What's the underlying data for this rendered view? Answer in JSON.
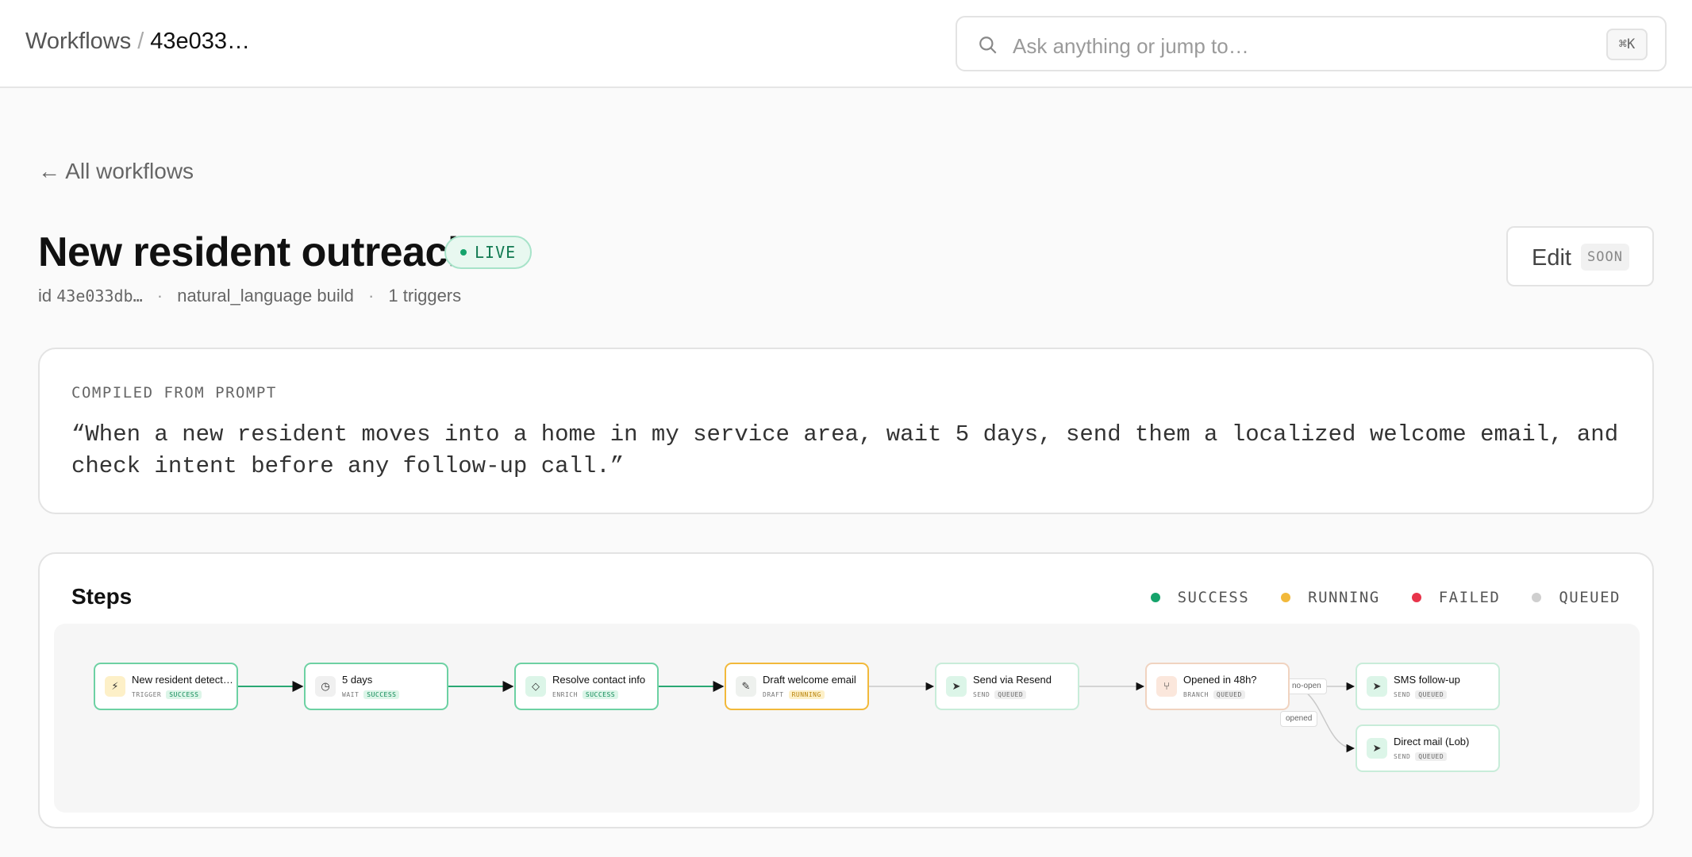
{
  "breadcrumb": {
    "root": "Workflows",
    "separator": "/",
    "current": "43e033…"
  },
  "search": {
    "placeholder": "Ask anything or jump to…",
    "shortcut": "⌘K",
    "icon": "search-icon"
  },
  "back_link": "← All workflows",
  "workflow": {
    "title": "New resident outreach",
    "status": "LIVE",
    "meta": {
      "id_label": "id",
      "id_value": "43e033db…",
      "build": "natural_language build",
      "triggers": "1 triggers"
    }
  },
  "edit_button": {
    "label": "Edit",
    "badge": "SOON"
  },
  "prompt_card": {
    "caption": "COMPILED FROM PROMPT",
    "text": "“When a new resident moves into a home in my service area, wait 5 days, send them a localized welcome email, and check intent before any follow-up call.”"
  },
  "steps_card": {
    "title": "Steps",
    "legend": [
      {
        "label": "SUCCESS",
        "color": "#15a36b"
      },
      {
        "label": "RUNNING",
        "color": "#f2b93b"
      },
      {
        "label": "FAILED",
        "color": "#e8344b"
      },
      {
        "label": "QUEUED",
        "color": "#cfcfcf"
      }
    ],
    "nodes": [
      {
        "title": "New resident detect…",
        "kind": "TRIGGER",
        "status": "SUCCESS",
        "icon": "lightning-icon",
        "glyph": "⚡",
        "icon_bg": "#fdf0c8"
      },
      {
        "title": "5 days",
        "kind": "WAIT",
        "status": "SUCCESS",
        "icon": "clock-icon",
        "glyph": "◷",
        "icon_bg": "#f0f0f0"
      },
      {
        "title": "Resolve contact info",
        "kind": "ENRICH",
        "status": "SUCCESS",
        "icon": "enrich-icon",
        "glyph": "◇",
        "icon_bg": "#dcf5e8"
      },
      {
        "title": "Draft welcome email",
        "kind": "DRAFT",
        "status": "RUNNING",
        "icon": "pencil-icon",
        "glyph": "✎",
        "icon_bg": "#eef1ee"
      },
      {
        "title": "Send via Resend",
        "kind": "SEND",
        "status": "QUEUED",
        "icon": "send-icon",
        "glyph": "➤",
        "icon_bg": "#dcf5e8"
      },
      {
        "title": "Opened in 48h?",
        "kind": "BRANCH",
        "status": "QUEUED",
        "icon": "branch-icon",
        "glyph": "⑂",
        "icon_bg": "#fbe7dc"
      },
      {
        "title": "SMS follow-up",
        "kind": "SEND",
        "status": "QUEUED",
        "icon": "send-icon",
        "glyph": "➤",
        "icon_bg": "#dcf5e8"
      },
      {
        "title": "Direct mail (Lob)",
        "kind": "SEND",
        "status": "QUEUED",
        "icon": "send-icon",
        "glyph": "➤",
        "icon_bg": "#dcf5e8"
      }
    ],
    "edge_labels": {
      "no_open": "no-open",
      "opened": "opened"
    }
  }
}
